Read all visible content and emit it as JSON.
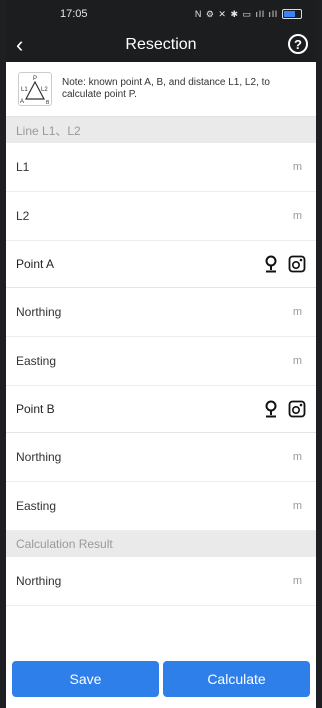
{
  "status": {
    "time": "17:05",
    "icons_text": "N ⚙ ✕ ✱ ▭ ıll ıll"
  },
  "header": {
    "title": "Resection",
    "back_icon": "‹",
    "help_icon": "?"
  },
  "note": {
    "text": "Note: known point A, B, and distance L1, L2, to calculate point P.",
    "diagram_labels": {
      "p": "P",
      "l1": "L1",
      "l2": "L2",
      "a": "A",
      "b": "B"
    }
  },
  "sections": {
    "lines": "Line L1、L2",
    "result": "Calculation Result"
  },
  "rows": {
    "l1": {
      "label": "L1",
      "unit": "m"
    },
    "l2": {
      "label": "L2",
      "unit": "m"
    },
    "a_northing": {
      "label": "Northing",
      "unit": "m"
    },
    "a_easting": {
      "label": "Easting",
      "unit": "m"
    },
    "b_northing": {
      "label": "Northing",
      "unit": "m"
    },
    "b_easting": {
      "label": "Easting",
      "unit": "m"
    },
    "r_northing": {
      "label": "Northing",
      "unit": "m"
    }
  },
  "points": {
    "a": {
      "label": "Point A"
    },
    "b": {
      "label": "Point B"
    }
  },
  "buttons": {
    "save": "Save",
    "calculate": "Calculate"
  },
  "colors": {
    "accent": "#2f7fea",
    "bar": "#1c1d1f",
    "section_bg": "#eaeaea"
  }
}
